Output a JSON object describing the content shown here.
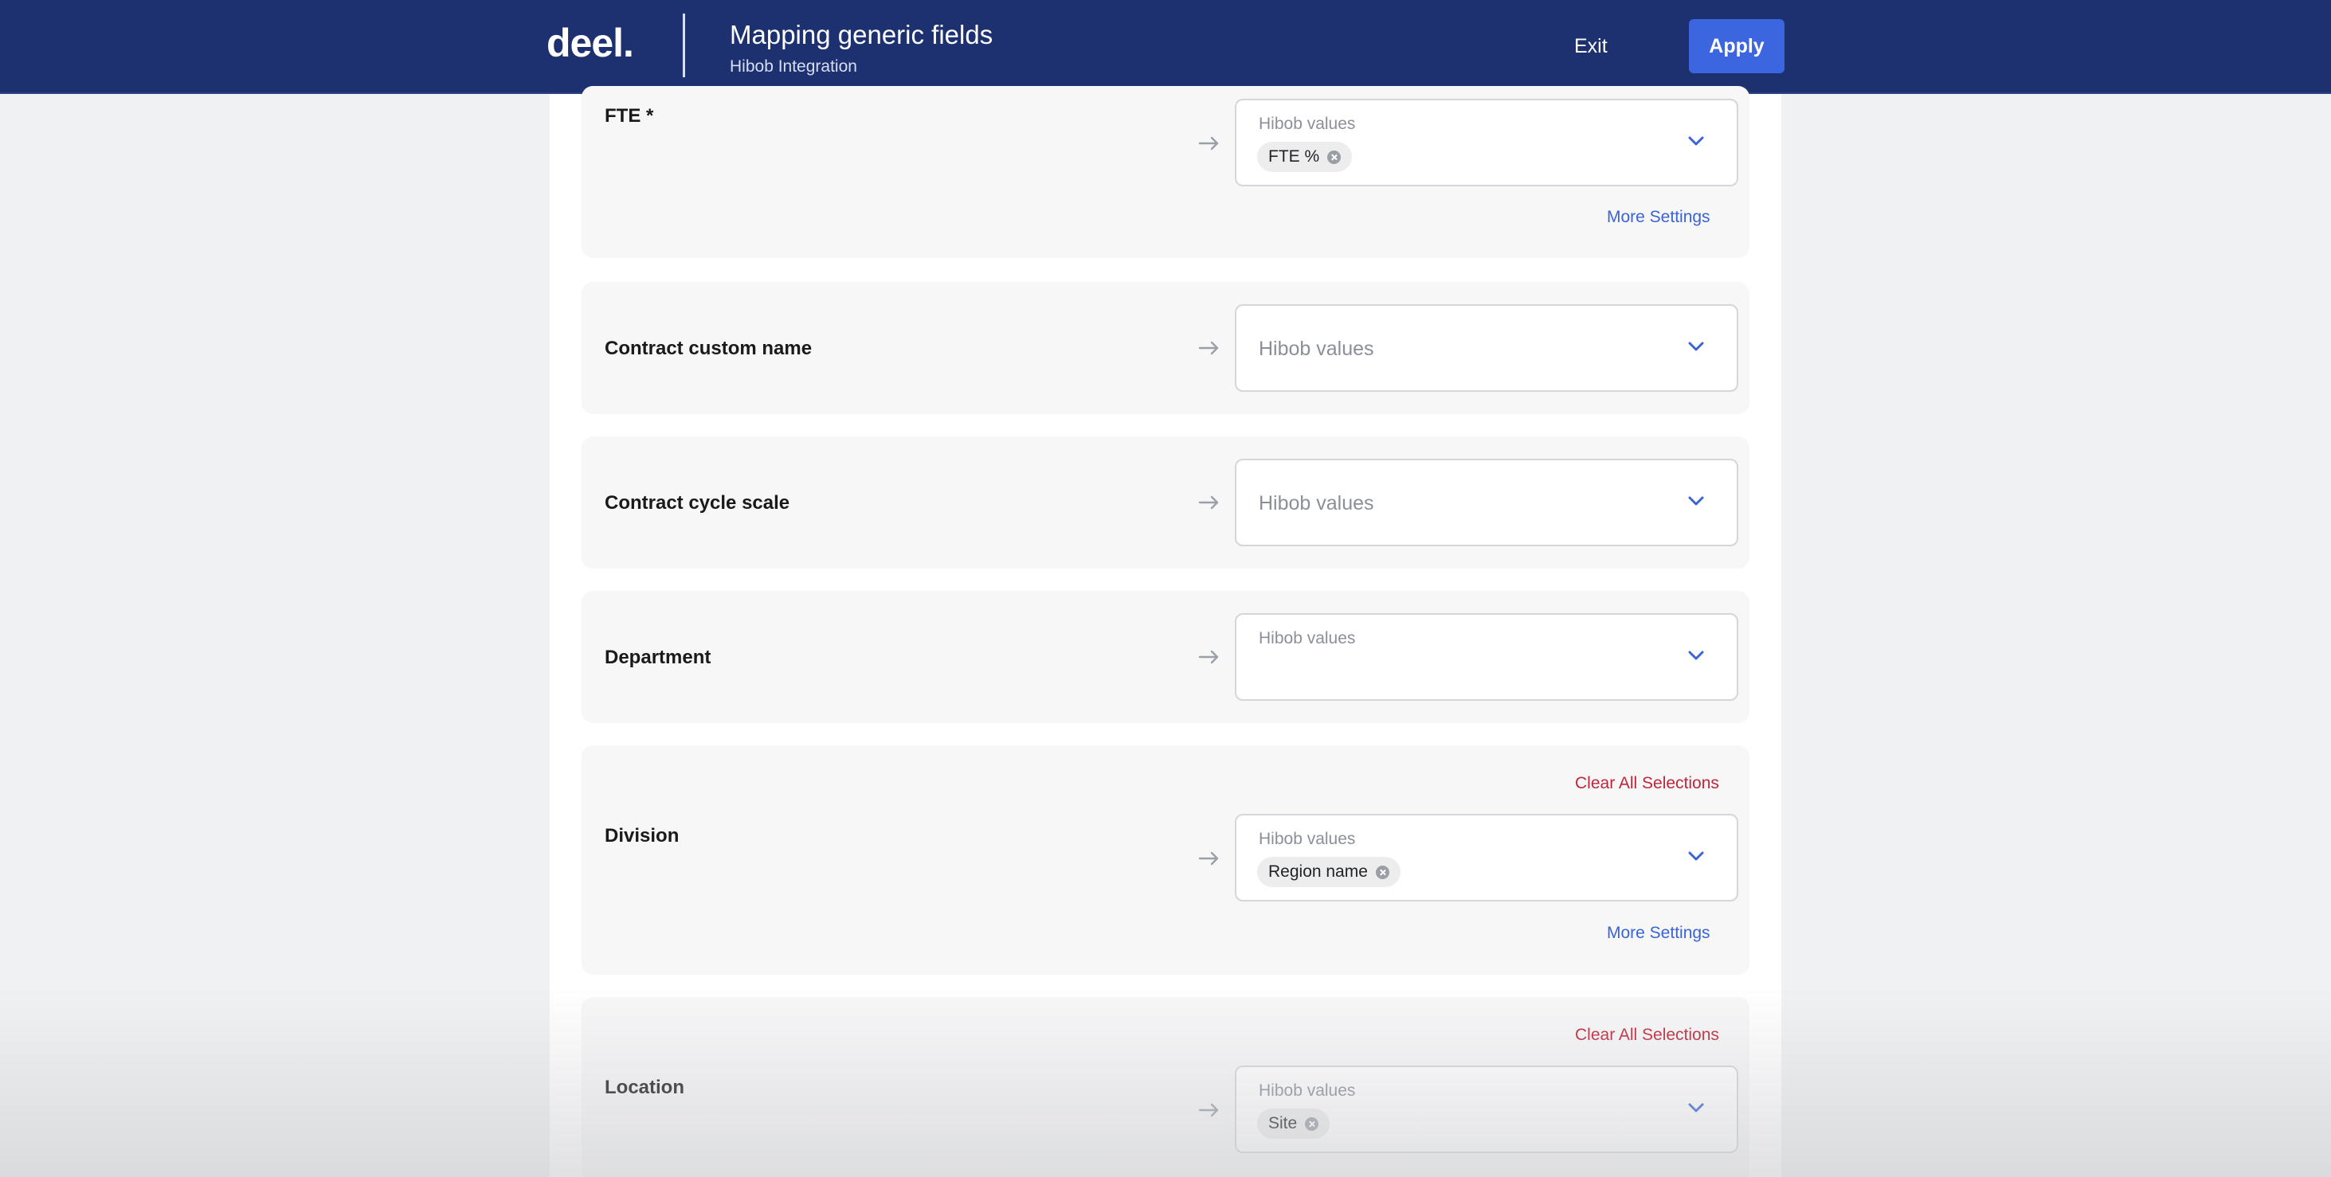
{
  "header": {
    "logo": "deel.",
    "title": "Mapping generic fields",
    "subtitle": "Hibob Integration",
    "exit_label": "Exit",
    "apply_label": "Apply"
  },
  "fields": [
    {
      "label": "FTE *",
      "select_placeholder": "Hibob values",
      "chip": "FTE %",
      "more_settings": "More Settings"
    },
    {
      "label": "Contract custom name",
      "select_placeholder": "Hibob values"
    },
    {
      "label": "Contract cycle scale",
      "select_placeholder": "Hibob values"
    },
    {
      "label": "Department",
      "select_placeholder": "Hibob values"
    },
    {
      "label": "Division",
      "clear_all": "Clear All Selections",
      "select_placeholder": "Hibob values",
      "chip": "Region name",
      "more_settings": "More Settings"
    },
    {
      "label": "Location",
      "clear_all": "Clear All Selections",
      "select_placeholder": "Hibob values",
      "chip": "Site"
    }
  ],
  "icons": {
    "arrow": "arrow-right-icon",
    "chevron": "chevron-down-icon",
    "chip_remove": "close-circle-icon"
  },
  "colors": {
    "header_bg": "#1d3170",
    "apply_bg": "#3c65e0",
    "link_blue": "#3a63d6",
    "link_red": "#c0263a"
  }
}
